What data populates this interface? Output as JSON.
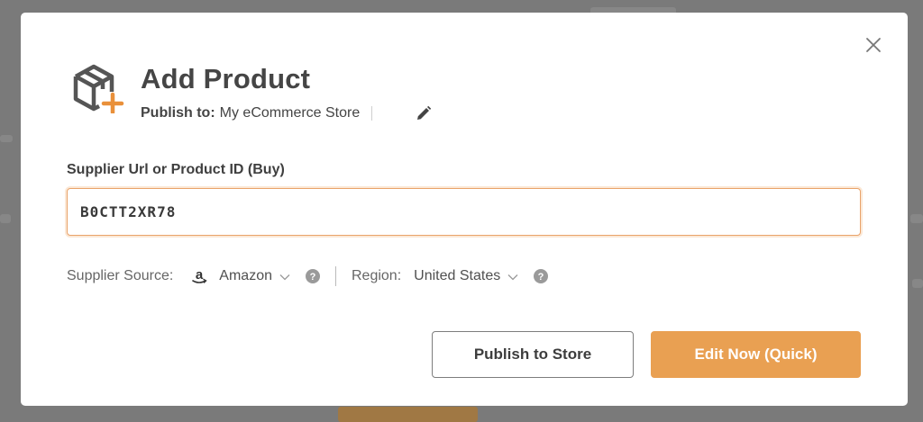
{
  "dialog": {
    "title": "Add Product",
    "publish_label": "Publish to:",
    "store_name": "My eCommerce Store"
  },
  "field": {
    "label": "Supplier Url or Product ID (Buy)",
    "value": "B0CTT2XR78"
  },
  "source": {
    "label": "Supplier Source:",
    "value": "Amazon",
    "region_label": "Region:",
    "region_value": "United States"
  },
  "buttons": {
    "publish": "Publish to Store",
    "edit": "Edit Now (Quick)"
  },
  "colors": {
    "accent": "#e9a052",
    "overlay": "#7a7a7a",
    "input_focus_border": "#e9a36a"
  },
  "icons": {
    "product": "package-add-icon",
    "close": "close-icon",
    "edit": "pencil-icon",
    "amazon": "amazon-logo-icon",
    "help": "help-circle-icon",
    "dropdown": "chevron-down-icon"
  }
}
